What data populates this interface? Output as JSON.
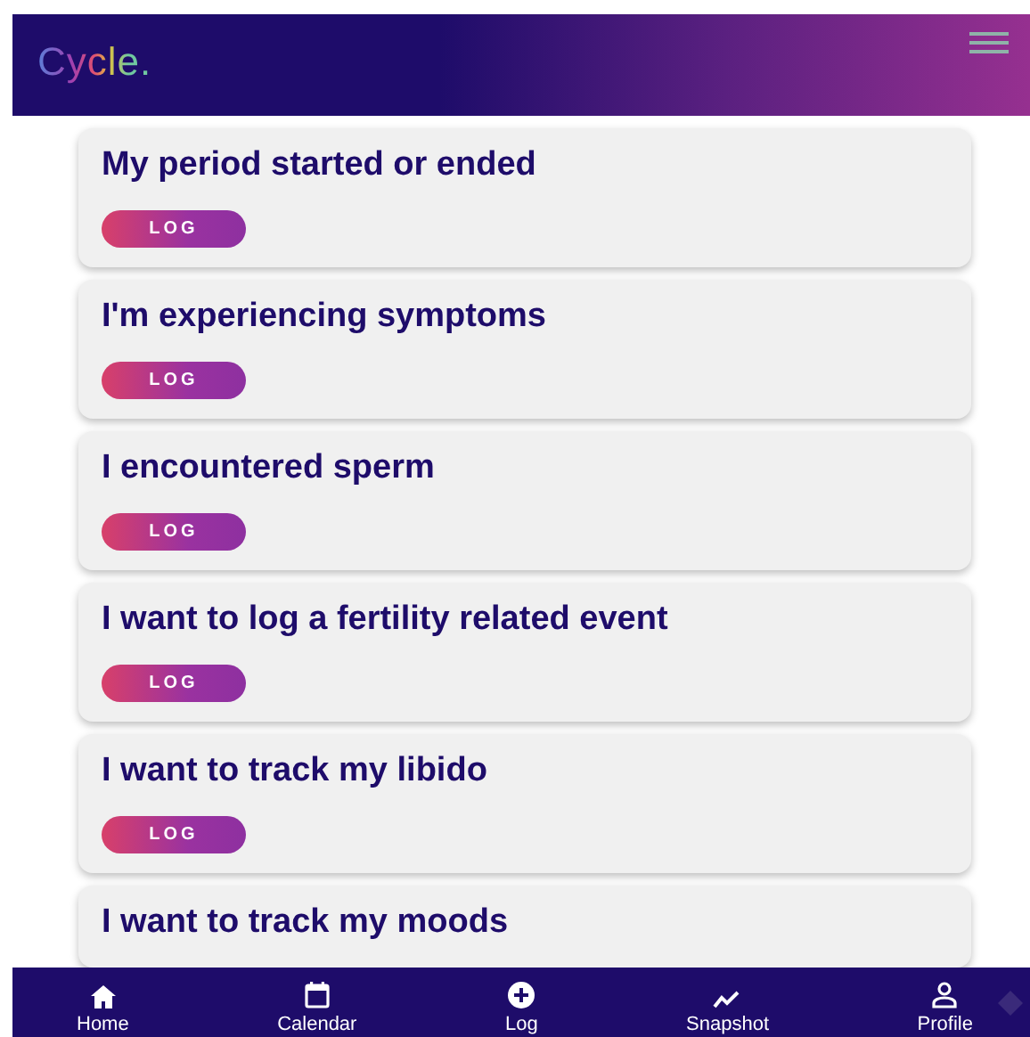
{
  "header": {
    "logo": "Cycle."
  },
  "cards": [
    {
      "title": "My period started or ended",
      "button": "LOG"
    },
    {
      "title": "I'm experiencing symptoms",
      "button": "LOG"
    },
    {
      "title": "I encountered sperm",
      "button": "LOG"
    },
    {
      "title": "I want to log a fertility related event",
      "button": "LOG"
    },
    {
      "title": "I want to track my libido",
      "button": "LOG"
    },
    {
      "title": "I want to track my moods"
    }
  ],
  "nav": [
    {
      "label": "Home",
      "kind": "home"
    },
    {
      "label": "Calendar",
      "kind": "calendar"
    },
    {
      "label": "Log",
      "kind": "plus"
    },
    {
      "label": "Snapshot",
      "kind": "chart"
    },
    {
      "label": "Profile",
      "kind": "person"
    }
  ]
}
